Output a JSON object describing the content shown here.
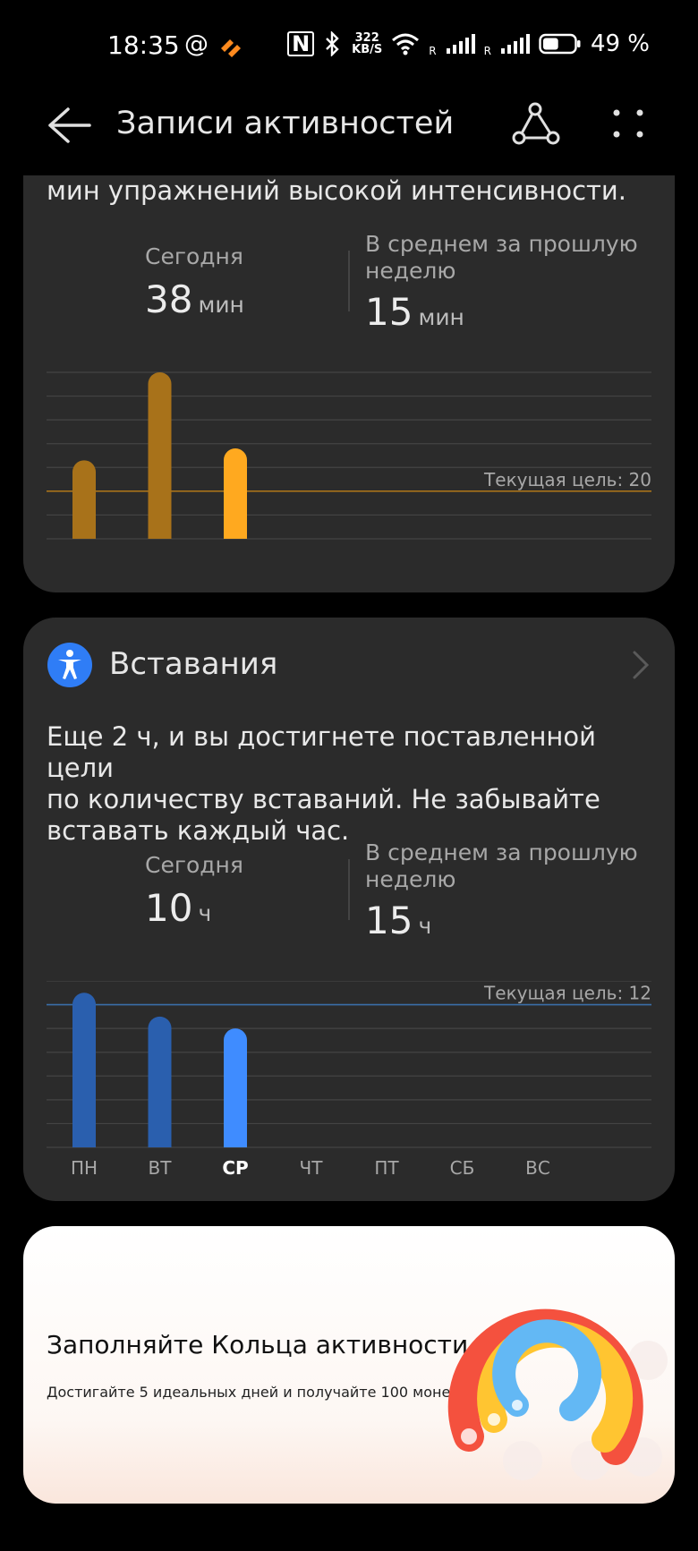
{
  "status_bar": {
    "time": "18:35",
    "at_sign": "@",
    "speed_value": "322",
    "speed_unit": "KB/S",
    "roaming_1": "R",
    "roaming_2": "R",
    "battery_percent": "49 %",
    "battery_level": 0.49
  },
  "header": {
    "title": "Записи активностей",
    "back_icon": "arrow-left-icon",
    "share_icon": "route-icon",
    "more_icon": "more-dots-icon"
  },
  "intensity_card": {
    "description_tail": "мин упражнений высокой интенсивности.",
    "today_label": "Сегодня",
    "today_value": "38",
    "today_unit": "мин",
    "avg_label_line1": "В среднем за прошлую",
    "avg_label_line2": "неделю",
    "avg_value": "15",
    "avg_unit": "мин",
    "goal_label": "Текущая цель: 20"
  },
  "stand_card": {
    "icon": "person-standing-icon",
    "title": "Вставания",
    "description_line1": "Еще 2 ч, и вы достигнете поставленной цели",
    "description_line2": "по количеству вставаний. Не забывайте",
    "description_line3": "вставать каждый час.",
    "today_label": "Сегодня",
    "today_value": "10",
    "today_unit": "ч",
    "avg_label_line1": "В среднем за прошлую",
    "avg_label_line2": "неделю",
    "avg_value": "15",
    "avg_unit": "ч",
    "goal_label": "Текущая цель: 12"
  },
  "promo_card": {
    "title": "Заполняйте Кольца активности",
    "subtitle": "Достигайте 5 идеальных дней и получайте 100 монет"
  },
  "chart_data": [
    {
      "type": "bar",
      "categories": [
        "ПН",
        "ВТ",
        "СР",
        "ЧТ",
        "ПТ",
        "СБ",
        "ВС"
      ],
      "values": [
        33,
        70,
        38,
        null,
        null,
        null,
        null
      ],
      "goal": 20,
      "ylim": [
        0,
        70
      ],
      "highlight_index": 2,
      "colors": {
        "bar": "#a8721a",
        "highlight": "#ffa91f",
        "goal_line": "#a8721a"
      }
    },
    {
      "type": "bar",
      "categories": [
        "ПН",
        "ВТ",
        "СР",
        "ЧТ",
        "ПТ",
        "СБ",
        "ВС"
      ],
      "values": [
        13,
        11,
        10,
        null,
        null,
        null,
        null
      ],
      "goal": 12,
      "ylim": [
        0,
        14
      ],
      "highlight_index": 2,
      "colors": {
        "bar": "#2a5fae",
        "highlight": "#3f8cff",
        "goal_line": "#3a6ea8"
      }
    }
  ]
}
